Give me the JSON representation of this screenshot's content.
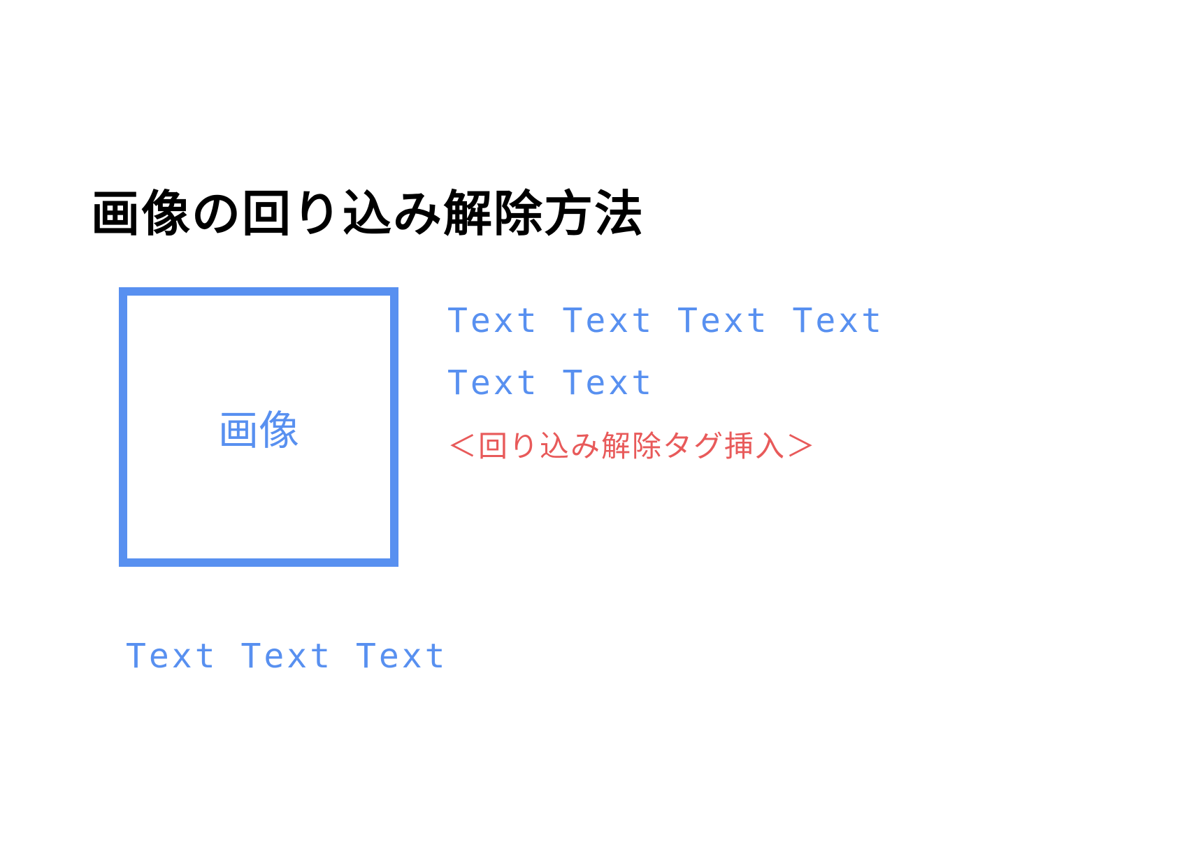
{
  "title": "画像の回り込み解除方法",
  "image_placeholder_label": "画像",
  "wrap_text_line1": "Text Text Text Text",
  "wrap_text_line2": "Text Text",
  "clear_tag_label": "＜回り込み解除タグ挿入＞",
  "bottom_text": "Text Text Text",
  "colors": {
    "blue": "#5890f0",
    "red": "#e85a5a",
    "black": "#000000"
  }
}
